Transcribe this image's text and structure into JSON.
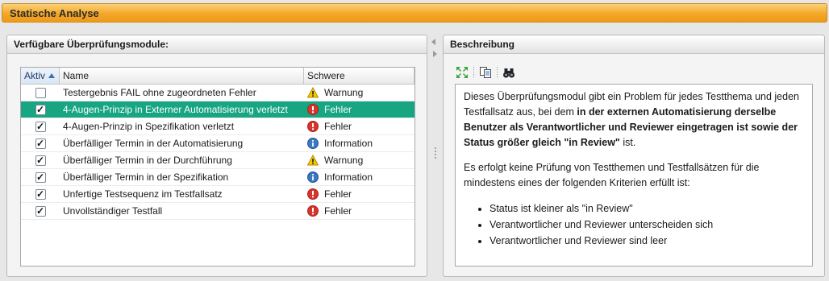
{
  "window": {
    "title": "Statische Analyse"
  },
  "left_panel": {
    "title": "Verfügbare Überprüfungsmodule:",
    "columns": {
      "active": "Aktiv",
      "name": "Name",
      "severity": "Schwere"
    },
    "rows": [
      {
        "active": false,
        "name": "Testergebnis FAIL ohne zugeordneten Fehler",
        "severity": "Warnung",
        "severity_type": "warning",
        "selected": false
      },
      {
        "active": true,
        "name": "4-Augen-Prinzip in Externer Automatisierung verletzt",
        "severity": "Fehler",
        "severity_type": "error",
        "selected": true
      },
      {
        "active": true,
        "name": "4-Augen-Prinzip in Spezifikation verletzt",
        "severity": "Fehler",
        "severity_type": "error",
        "selected": false
      },
      {
        "active": true,
        "name": "Überfälliger Termin in der Automatisierung",
        "severity": "Information",
        "severity_type": "info",
        "selected": false
      },
      {
        "active": true,
        "name": "Überfälliger Termin in der Durchführung",
        "severity": "Warnung",
        "severity_type": "warning",
        "selected": false
      },
      {
        "active": true,
        "name": "Überfälliger Termin in der Spezifikation",
        "severity": "Information",
        "severity_type": "info",
        "selected": false
      },
      {
        "active": true,
        "name": "Unfertige Testsequenz im Testfallsatz",
        "severity": "Fehler",
        "severity_type": "error",
        "selected": false
      },
      {
        "active": true,
        "name": "Unvollständiger Testfall",
        "severity": "Fehler",
        "severity_type": "error",
        "selected": false
      }
    ]
  },
  "right_panel": {
    "title": "Beschreibung",
    "toolbar": [
      {
        "icon": "expand-icon"
      },
      {
        "icon": "copy-icon"
      },
      {
        "icon": "binoculars-icon"
      }
    ],
    "description": {
      "p1_plain": "Dieses Überprüfungsmodul gibt ein Problem für jedes Testthema und jeden Testfallsatz aus, bei dem ",
      "p1_bold": "in der externen Automatisierung derselbe Benutzer als Verantwortlicher und Reviewer eingetragen ist sowie der Status größer gleich \"in Review\"",
      "p1_end": " ist.",
      "p2": "Es erfolgt keine Prüfung von Testthemen und Testfallsätzen für die mindestens eines der folgenden Kriterien erfüllt ist:",
      "bullets": [
        "Status ist kleiner als \"in Review\"",
        "Verantwortlicher und Reviewer unterscheiden sich",
        "Verantwortlicher und Reviewer sind leer"
      ]
    }
  },
  "colors": {
    "selection": "#17a582",
    "title_bar": "#f3a728",
    "error": "#d9342b",
    "warning": "#f2c200",
    "info": "#3a78c2"
  }
}
